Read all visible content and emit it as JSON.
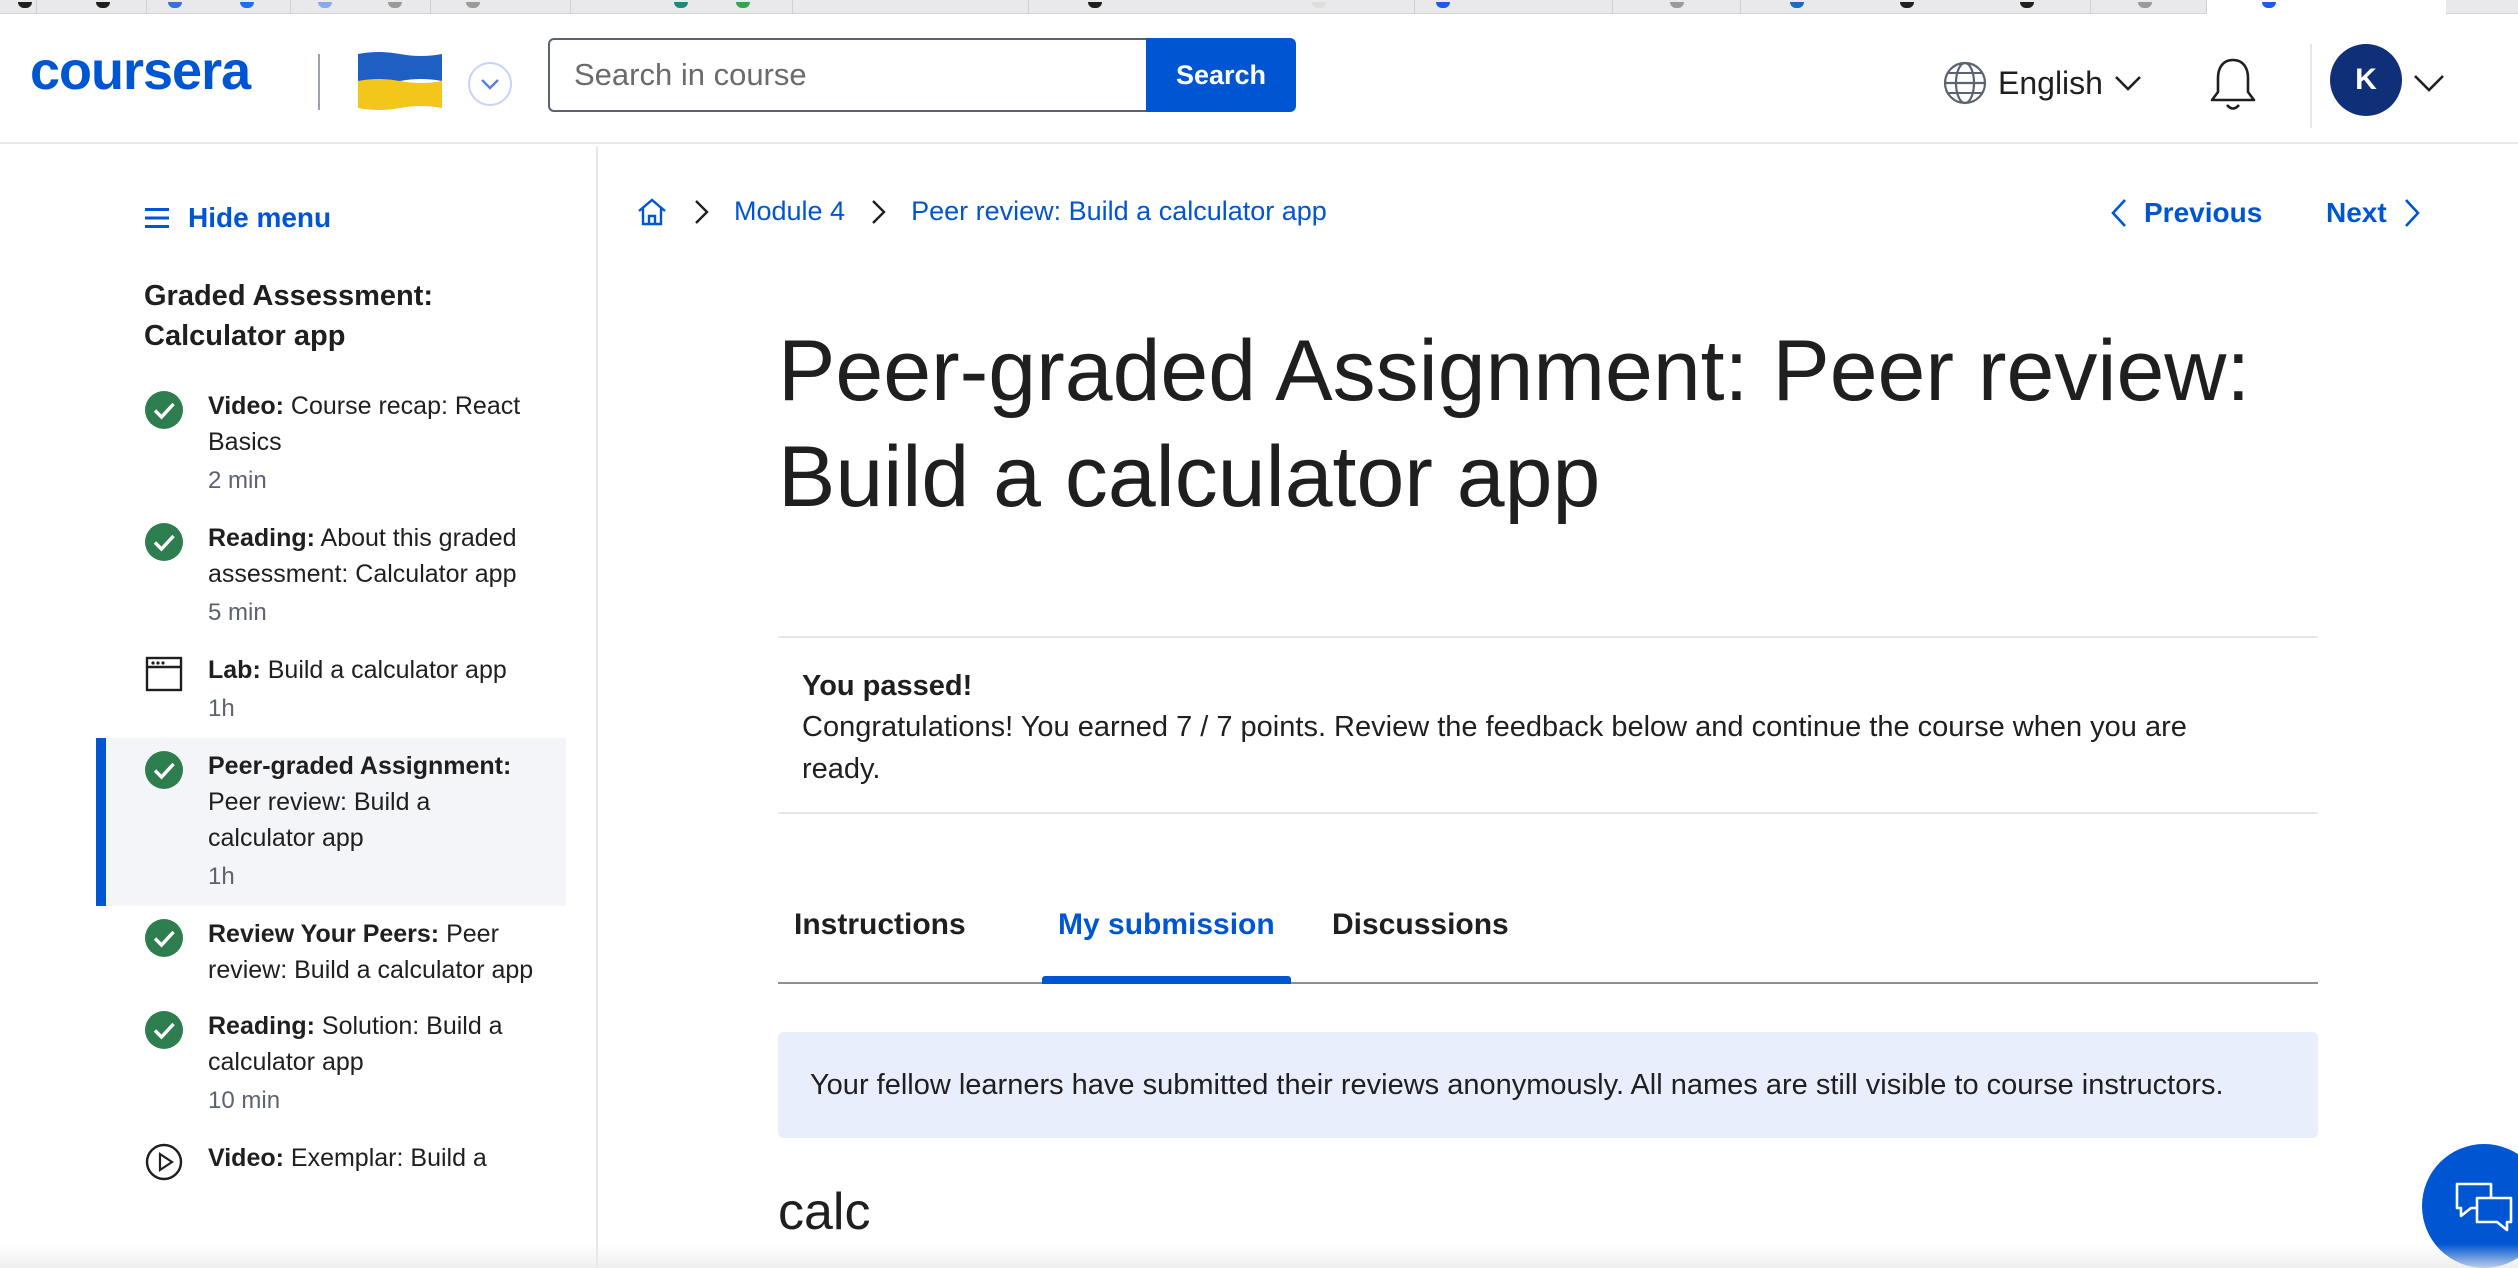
{
  "colors": {
    "accent": "#0056d2",
    "success": "#2e7d4f",
    "avatar_bg": "#0f2f78",
    "notice_bg": "#e8eefb"
  },
  "header": {
    "logo": "coursera",
    "flag_icon": "ukraine-flag-icon",
    "search_placeholder": "Search in course",
    "search_button": "Search",
    "language": "English",
    "avatar_initial": "K"
  },
  "sidebar": {
    "hide_menu": "Hide menu",
    "title": "Graded Assessment: Calculator app",
    "items": [
      {
        "type": "Video:",
        "title": "Course recap: React Basics",
        "duration": "2 min",
        "status": "completed",
        "icon": "check-circle-icon",
        "active": false
      },
      {
        "type": "Reading:",
        "title": "About this graded assessment: Calculator app",
        "duration": "5 min",
        "status": "completed",
        "icon": "check-circle-icon",
        "active": false
      },
      {
        "type": "Lab:",
        "title": "Build a calculator app",
        "duration": "1h",
        "status": "not-started",
        "icon": "lab-window-icon",
        "active": false
      },
      {
        "type": "Peer-graded Assignment:",
        "title": "Peer review: Build a calculator app",
        "duration": "1h",
        "status": "completed",
        "icon": "check-circle-icon",
        "active": true
      },
      {
        "type": "Review Your Peers:",
        "title": "Peer review: Build a calculator app",
        "duration": "",
        "status": "completed",
        "icon": "check-circle-icon",
        "active": false
      },
      {
        "type": "Reading:",
        "title": "Solution: Build a calculator app",
        "duration": "10 min",
        "status": "completed",
        "icon": "check-circle-icon",
        "active": false
      },
      {
        "type": "Video:",
        "title": "Exemplar: Build a",
        "duration": "",
        "status": "not-started",
        "icon": "play-circle-icon",
        "active": false
      }
    ]
  },
  "breadcrumb": {
    "module": "Module 4",
    "current": "Peer review: Build a calculator app"
  },
  "nav": {
    "previous": "Previous",
    "next": "Next"
  },
  "main": {
    "title": "Peer-graded Assignment: Peer review: Build a calculator app",
    "result_heading": "You passed!",
    "result_text": "Congratulations! You earned 7 / 7 points. Review the feedback below and continue the course when you are ready.",
    "tabs": [
      "Instructions",
      "My submission",
      "Discussions"
    ],
    "selected_tab": "My submission",
    "notice": "Your fellow learners have submitted their reviews anonymously. All names are still visible to course instructors.",
    "submission_title": "calc"
  }
}
